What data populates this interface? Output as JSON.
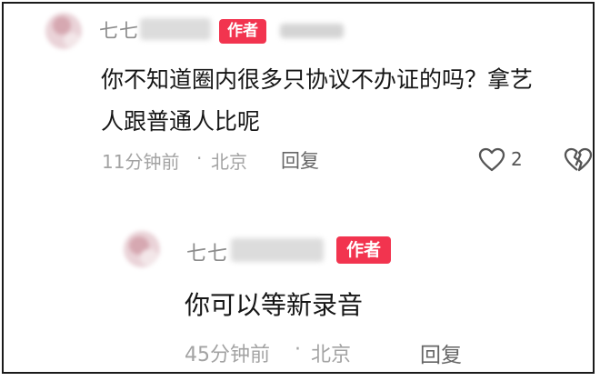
{
  "comment": {
    "name_visible": "七七",
    "author_badge": "作者",
    "text_line1": "你不知道圈内很多只协议不办证的吗？拿艺",
    "text_line2": "人跟普通人比呢",
    "time": "11分钟前",
    "separator": "·",
    "location": "北京",
    "reply_label": "回复",
    "like_count": "2",
    "like_icon": "heart-outline-icon",
    "dislike_icon": "broken-heart-icon"
  },
  "reply": {
    "name_visible": "七七",
    "author_badge": "作者",
    "text": "你可以等新录音",
    "time": "45分钟前",
    "separator": "·",
    "location": "北京",
    "reply_label": "回复"
  },
  "colors": {
    "badge": "#f2344f",
    "text": "#161616",
    "meta": "#a3a3a3"
  }
}
